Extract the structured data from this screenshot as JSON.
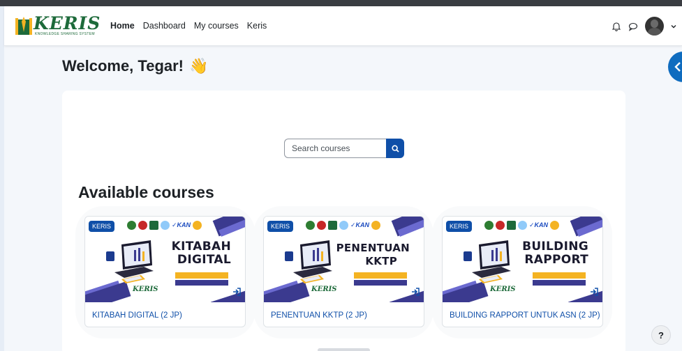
{
  "brand": {
    "name": "KERIS",
    "tagline": "KNOWLEDGE SHARING SYSTEM",
    "green": "#1d6a3a"
  },
  "nav": {
    "links": [
      "Home",
      "Dashboard",
      "My courses",
      "Keris"
    ],
    "active": "Home"
  },
  "welcome": {
    "text": "Welcome, Tegar!",
    "emoji": "👋"
  },
  "search": {
    "placeholder": "Search courses"
  },
  "available": {
    "title": "Available courses",
    "courses": [
      {
        "badge": "KERIS",
        "image_title_lines": [
          "KITABAH",
          "DIGITAL"
        ],
        "name": "KITABAH DIGITAL (2 JP)"
      },
      {
        "badge": "KERIS",
        "image_title_lines": [
          "PENENTUAN",
          "KKTP"
        ],
        "name": "PENENTUAN KKTP (2 JP)"
      },
      {
        "badge": "KERIS",
        "image_title_lines": [
          "BUILDING",
          "RAPPORT"
        ],
        "name": "BUILDING RAPPORT UNTUK ASN (2 JP)"
      }
    ]
  },
  "help": {
    "label": "?"
  },
  "colors": {
    "primary": "#0f4fa8",
    "drawer": "#0f6cbf",
    "banner_purple": "#3b3a8f",
    "banner_gold": "#f4b322"
  }
}
